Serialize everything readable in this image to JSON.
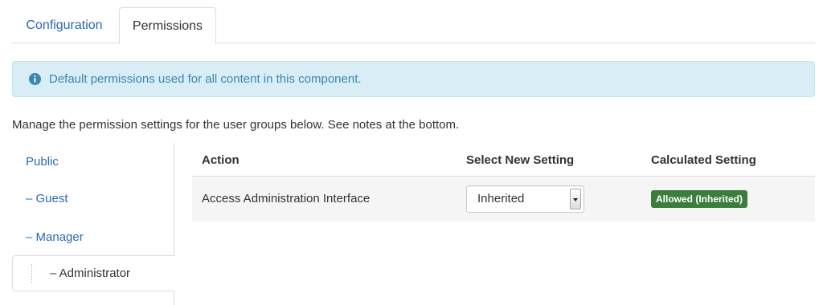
{
  "tabs": [
    {
      "label": "Configuration",
      "active": false
    },
    {
      "label": "Permissions",
      "active": true
    }
  ],
  "alert": {
    "icon": "info-icon",
    "text": "Default permissions used for all content in this component."
  },
  "intro": "Manage the permission settings for the user groups below. See notes at the bottom.",
  "groups": [
    {
      "label": "Public",
      "active": false
    },
    {
      "label": "– Guest",
      "active": false
    },
    {
      "label": "– Manager",
      "active": false
    },
    {
      "label": "– Administrator",
      "active": true
    }
  ],
  "table": {
    "headers": [
      "Action",
      "Select New Setting",
      "Calculated Setting"
    ],
    "rows": [
      {
        "action": "Access Administration Interface",
        "setting": "Inherited",
        "calculated": "Allowed (Inherited)"
      }
    ]
  },
  "colors": {
    "link": "#2a69b8",
    "alert_bg": "#d9edf7",
    "alert_text": "#3a87ad",
    "badge_success": "#3b7d3c"
  }
}
